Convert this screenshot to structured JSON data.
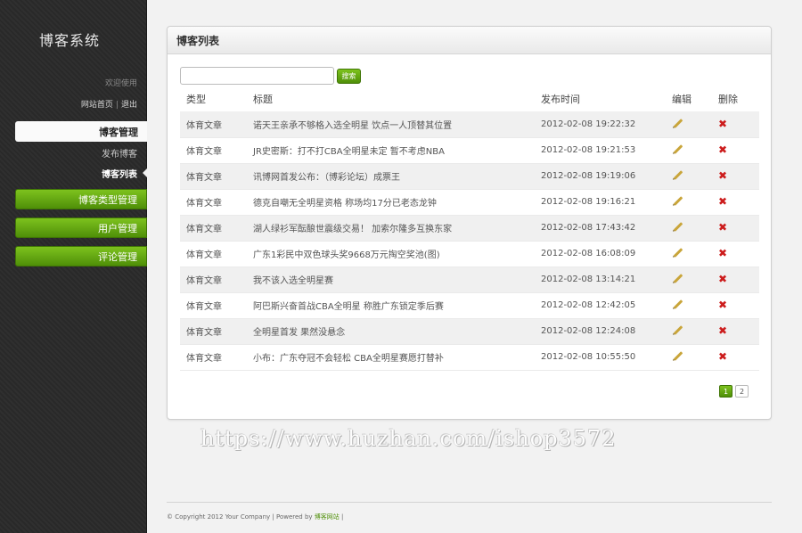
{
  "app": {
    "title": "博客系统"
  },
  "user_area": {
    "welcome": "欢迎使用",
    "home_link": "网站首页",
    "separator": "|",
    "logout_link": "退出"
  },
  "nav": {
    "blog_manage": "博客管理",
    "sub_items": [
      {
        "label": "发布博客"
      },
      {
        "label": "博客列表"
      }
    ],
    "blog_type_manage": "博客类型管理",
    "user_manage": "用户管理",
    "comment_manage": "评论管理"
  },
  "panel": {
    "title": "博客列表"
  },
  "search": {
    "placeholder": "",
    "button": "搜索"
  },
  "table": {
    "headers": [
      "类型",
      "标题",
      "发布时间",
      "编辑",
      "删除"
    ],
    "rows": [
      {
        "type": "体育文章",
        "title": "诺天王亲承不够格入选全明星 饮点一人顶替其位置",
        "time": "2012-02-08 19:22:32"
      },
      {
        "type": "体育文章",
        "title": "JR史密斯：打不打CBA全明星未定 暂不考虑NBA",
        "time": "2012-02-08 19:21:53"
      },
      {
        "type": "体育文章",
        "title": "讯博网首发公布：（博彩论坛）成票王",
        "time": "2012-02-08 19:19:06"
      },
      {
        "type": "体育文章",
        "title": "德克自嘲无全明星资格 称场均17分已老态龙钟",
        "time": "2012-02-08 19:16:21"
      },
      {
        "type": "体育文章",
        "title": "湖人绿衫军酝酿世震级交易！ 加索尔隆多互换东家",
        "time": "2012-02-08 17:43:42"
      },
      {
        "type": "体育文章",
        "title": "广东1彩民中双色球头奖9668万元掏空奖池(图)",
        "time": "2012-02-08 16:08:09"
      },
      {
        "type": "体育文章",
        "title": "我不该入选全明星赛",
        "time": "2012-02-08 13:14:21"
      },
      {
        "type": "体育文章",
        "title": "阿巴斯兴奋首战CBA全明星 称胜广东锁定季后赛",
        "time": "2012-02-08 12:42:05"
      },
      {
        "type": "体育文章",
        "title": "全明星首发 果然没悬念",
        "time": "2012-02-08 12:24:08"
      },
      {
        "type": "体育文章",
        "title": "小布：广东夺冠不会轻松 CBA全明星赛愿打替补",
        "time": "2012-02-08 10:55:50"
      }
    ]
  },
  "pagination": {
    "pages": [
      "1",
      "2"
    ],
    "current": "1"
  },
  "watermark": "https://www.huzhan.com/ishop3572",
  "footer": {
    "copyright": "© Copyright 2012 Your Company | Powered by ",
    "powered_link": "博客网站",
    "tail": " |"
  },
  "colors": {
    "accent": "#5fa312",
    "delete": "#cc1c1c",
    "edit": "#c9a53a"
  },
  "icons": {
    "edit": "pencil-icon",
    "delete": "delete-x-icon"
  }
}
